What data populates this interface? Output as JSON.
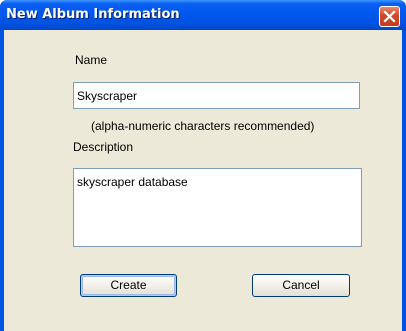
{
  "window": {
    "title": "New Album Information",
    "close_icon": "close-icon"
  },
  "form": {
    "name_label": "Name",
    "name_value": "Skyscraper",
    "hint": "(alpha-numeric characters recommended)",
    "description_label": "Description",
    "description_value": "skyscraper database"
  },
  "buttons": {
    "create_label": "Create",
    "cancel_label": "Cancel"
  },
  "colors": {
    "titlebar": "#0058ee",
    "dialog_face": "#ece9d8",
    "close_button": "#d2472a",
    "input_border": "#7f9db9"
  }
}
